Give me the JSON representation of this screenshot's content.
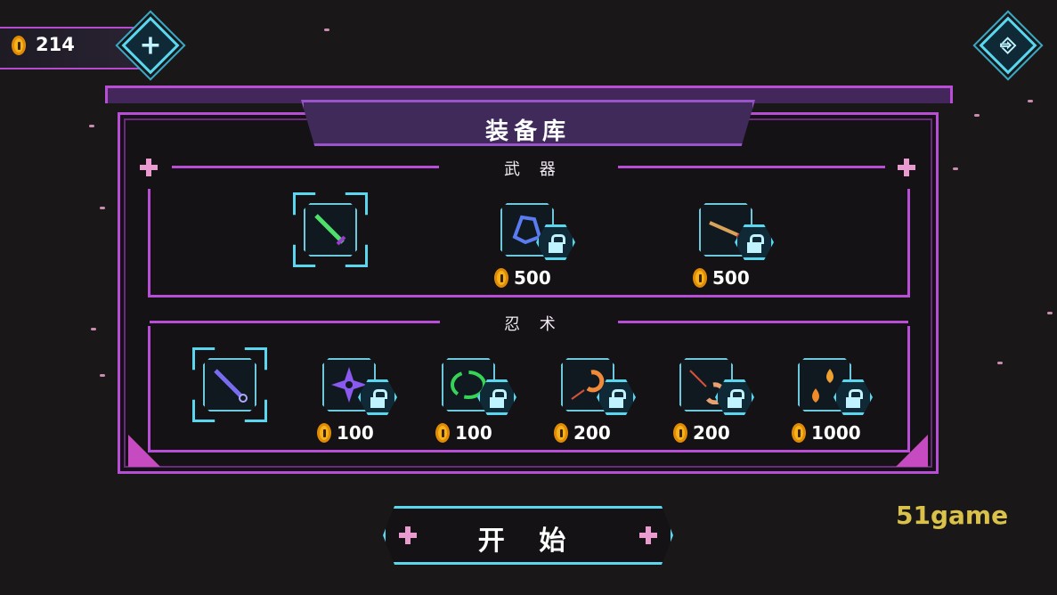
{
  "hud": {
    "coins": "214",
    "add_icon": "plus-icon",
    "exit_icon": "exit-door-icon"
  },
  "panel": {
    "title": "装备库",
    "weapons_label": "武 器",
    "ninjutsu_label": "忍 术"
  },
  "weapons": [
    {
      "name_icon": "green-katana-icon",
      "locked": false,
      "selected": true,
      "price": ""
    },
    {
      "name_icon": "blue-gauntlet-icon",
      "locked": true,
      "selected": false,
      "price": "500"
    },
    {
      "name_icon": "flame-spear-icon",
      "locked": true,
      "selected": false,
      "price": "500"
    }
  ],
  "ninjutsu": [
    {
      "name_icon": "kunai-icon",
      "locked": false,
      "selected": true,
      "price": ""
    },
    {
      "name_icon": "shuriken-icon",
      "locked": true,
      "selected": false,
      "price": "100"
    },
    {
      "name_icon": "green-ring-icon",
      "locked": true,
      "selected": false,
      "price": "100"
    },
    {
      "name_icon": "fire-swirl-icon",
      "locked": true,
      "selected": false,
      "price": "200"
    },
    {
      "name_icon": "fire-slash-icon",
      "locked": true,
      "selected": false,
      "price": "200"
    },
    {
      "name_icon": "flame-drops-icon",
      "locked": true,
      "selected": false,
      "price": "1000"
    }
  ],
  "start_button": "开 始",
  "watermark": "51game",
  "colors": {
    "frame": "#b84ed5",
    "cyan": "#5ad7ee",
    "coin": "#f6b21a",
    "background": "#1a1719"
  }
}
